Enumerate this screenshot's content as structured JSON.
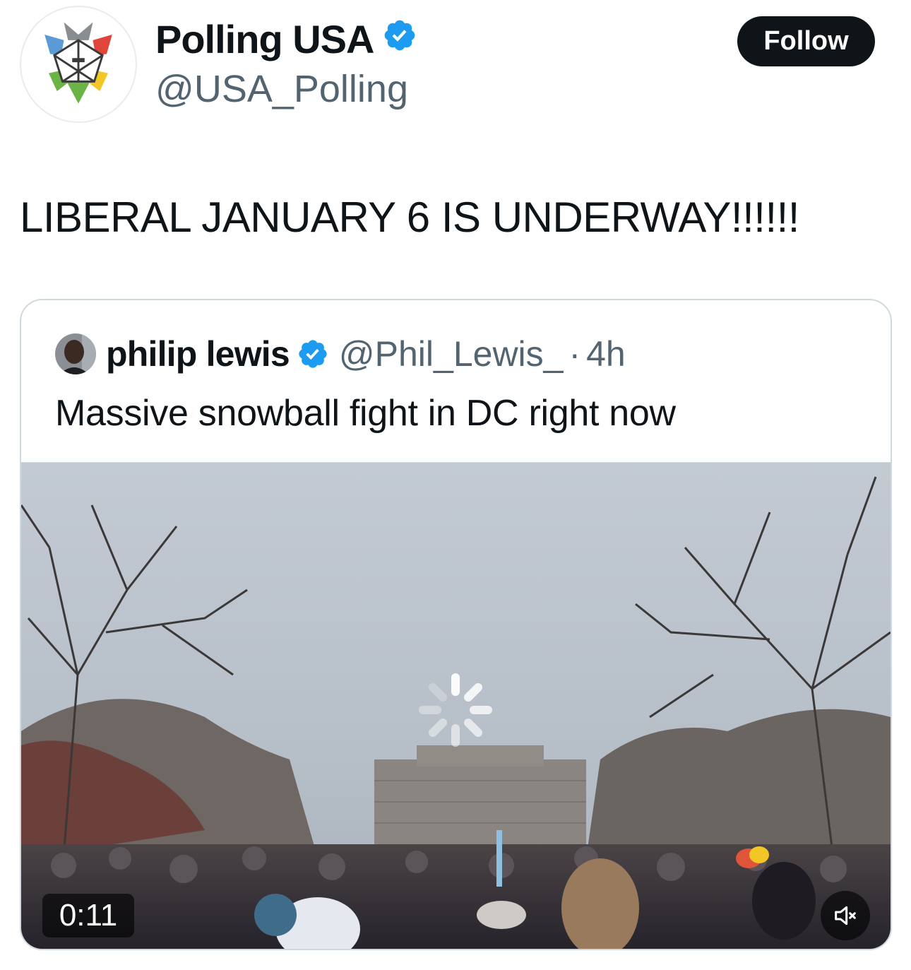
{
  "author": {
    "display_name": "Polling USA",
    "handle": "@USA_Polling",
    "avatar_icon": "polling-usa-star-logo",
    "verified": true
  },
  "follow_button": {
    "label": "Follow"
  },
  "tweet": {
    "text": "LIBERAL JANUARY 6 IS UNDERWAY!!!!!!"
  },
  "quoted_tweet": {
    "display_name": "philip lewis",
    "handle": "@Phil_Lewis_",
    "separator": "·",
    "time": "4h",
    "verified": true,
    "text": "Massive snowball fight in DC right now",
    "video": {
      "duration": "0:11",
      "state": "loading",
      "muted": true,
      "mute_icon": "speaker-muted-icon"
    }
  },
  "colors": {
    "verified_blue": "#1d9bf0",
    "follow_bg": "#0f1419",
    "secondary_text": "#536471",
    "border": "#cfd9de"
  }
}
